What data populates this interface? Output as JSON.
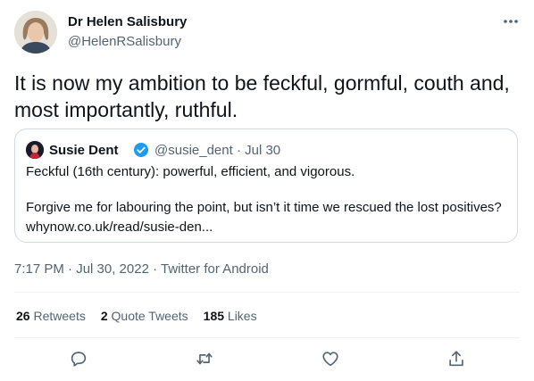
{
  "author": {
    "name": "Dr Helen Salisbury",
    "handle": "@HelenRSalisbury"
  },
  "tweet": {
    "text": "It is now my ambition to be feckful, gormful, couth and, most importantly, ruthful."
  },
  "quote": {
    "name": "Susie Dent",
    "handle": "@susie_dent",
    "date": "· Jul 30",
    "line1": "Feckful (16th century): powerful, efficient, and vigorous.",
    "line2": "Forgive me for labouring the point, but isn’t it time we rescued the lost positives?",
    "link": "whynow.co.uk/read/susie-den..."
  },
  "meta": {
    "time": "7:17 PM · Jul 30, 2022",
    "sep": " · ",
    "client": "Twitter for Android"
  },
  "stats": {
    "retweets": {
      "count": "26",
      "label": "Retweets"
    },
    "quotes": {
      "count": "2",
      "label": "Quote Tweets"
    },
    "likes": {
      "count": "185",
      "label": "Likes"
    }
  },
  "actions": [
    "reply-icon",
    "retweet-icon",
    "like-icon",
    "share-icon"
  ],
  "colors": {
    "text": "#0f1419",
    "secondary": "#536471",
    "border": "#cfd9de",
    "verified": "#1d9bf0"
  }
}
